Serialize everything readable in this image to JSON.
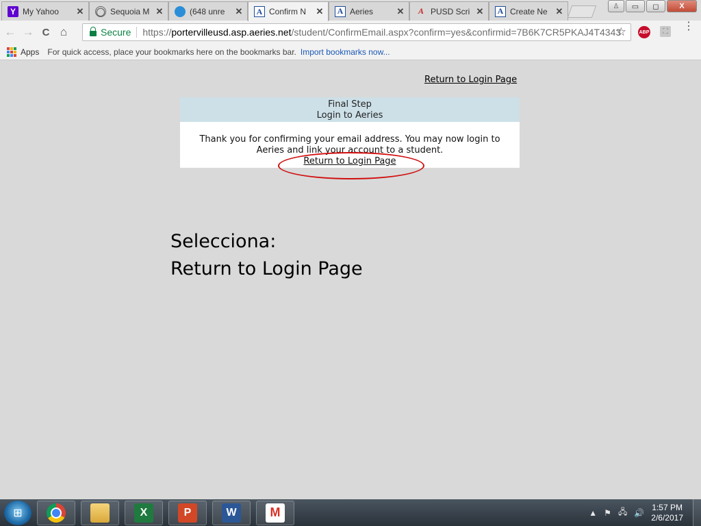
{
  "browser": {
    "tabs": [
      {
        "title": "My Yahoo",
        "icon": "yahoo-icon",
        "active": false
      },
      {
        "title": "Sequoia M",
        "icon": "globe-icon",
        "active": false
      },
      {
        "title": "(648 unre",
        "icon": "att-icon",
        "active": false
      },
      {
        "title": "Confirm N",
        "icon": "aeries-icon",
        "active": true
      },
      {
        "title": "Aeries",
        "icon": "aeries-icon",
        "active": false
      },
      {
        "title": "PUSD Scri",
        "icon": "pusd-icon",
        "active": false
      },
      {
        "title": "Create Ne",
        "icon": "aeries-icon",
        "active": false
      }
    ],
    "tab_close_glyph": "✕",
    "favicon_glyphs": {
      "yahoo": "Y",
      "aeries": "A",
      "pusd": "A"
    },
    "window_controls": {
      "minimize": "▭",
      "maximize": "◻",
      "close": "X",
      "profile": "♙"
    },
    "nav": {
      "back": "←",
      "forward": "→",
      "reload": "C",
      "home": "⌂"
    },
    "address": {
      "secure_label": "Secure",
      "scheme": "https://",
      "host": "portervilleusd.asp.aeries.net",
      "path": "/student/ConfirmEmail.aspx?confirm=yes&confirmid=7B6K7CR5PKAJ4T4343"
    },
    "star_glyph": "☆",
    "extension_abp": "ABP",
    "menu_glyph": "⋮",
    "bookmarks_bar": {
      "apps_label": "Apps",
      "hint_text": "For quick access, place your bookmarks here on the bookmarks bar.",
      "import_link": "Import bookmarks now..."
    }
  },
  "page": {
    "top_link": "Return to Login Page",
    "panel": {
      "header_line1": "Final Step",
      "header_line2": "Login to Aeries",
      "message": "Thank you for confirming your email address. You may now login to Aeries and link your account to a student.",
      "link": "Return to Login Page"
    },
    "instruction_line1": "Selecciona:",
    "instruction_line2": "Return to Login Page"
  },
  "taskbar": {
    "apps": [
      {
        "name": "chrome",
        "glyph": ""
      },
      {
        "name": "file-explorer",
        "glyph": ""
      },
      {
        "name": "excel",
        "glyph": "X"
      },
      {
        "name": "powerpoint",
        "glyph": "P"
      },
      {
        "name": "word",
        "glyph": "W"
      },
      {
        "name": "gmail",
        "glyph": "M"
      }
    ],
    "tray": {
      "expand": "▲",
      "flag": "⚑",
      "network": "🖧",
      "volume": "🔊"
    },
    "time": "1:57 PM",
    "date": "2/6/2017"
  },
  "colors": {
    "page_background": "#d9d9d9",
    "panel_header": "#cde0e8",
    "callout_red": "#d10f0f",
    "secure_green": "#0b8043",
    "link_blue": "#1a58b5"
  }
}
